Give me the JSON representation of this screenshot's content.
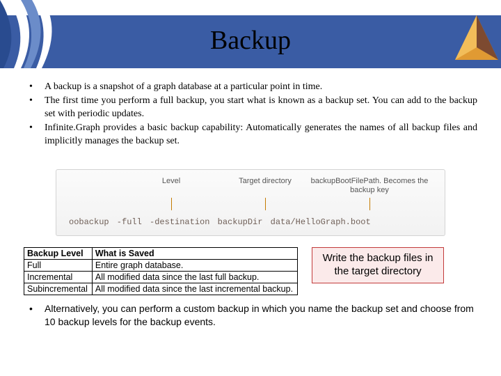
{
  "title": "Backup",
  "intro_bullets": [
    "A backup is a snapshot of a graph database at a particular point in time.",
    "The first time you perform a full backup, you start what is known as a backup set. You can add to the backup set with periodic updates.",
    "Infinite.Graph provides a basic backup capability: Automatically generates the names of all backup files and implicitly manages the backup set."
  ],
  "diagram": {
    "labels": {
      "l1": "Level",
      "l2": "Target directory",
      "l3": "backupBootFilePath. Becomes the backup key"
    },
    "command": "oobackup -full  -destination backupDir  data/HelloGraph.boot"
  },
  "table": {
    "headers": {
      "col1": "Backup Level",
      "col2": "What is Saved"
    },
    "rows": [
      {
        "level": "Full",
        "desc": "Entire graph database."
      },
      {
        "level": "Incremental",
        "desc": "All modified data since the last full backup."
      },
      {
        "level": "Subincremental",
        "desc": "All modified data since the last incremental backup."
      }
    ]
  },
  "note": "Write the backup files in the target directory",
  "outro_bullet": "Alternatively, you can perform a custom backup in which you name the backup set and choose from 10 backup levels for the backup events."
}
